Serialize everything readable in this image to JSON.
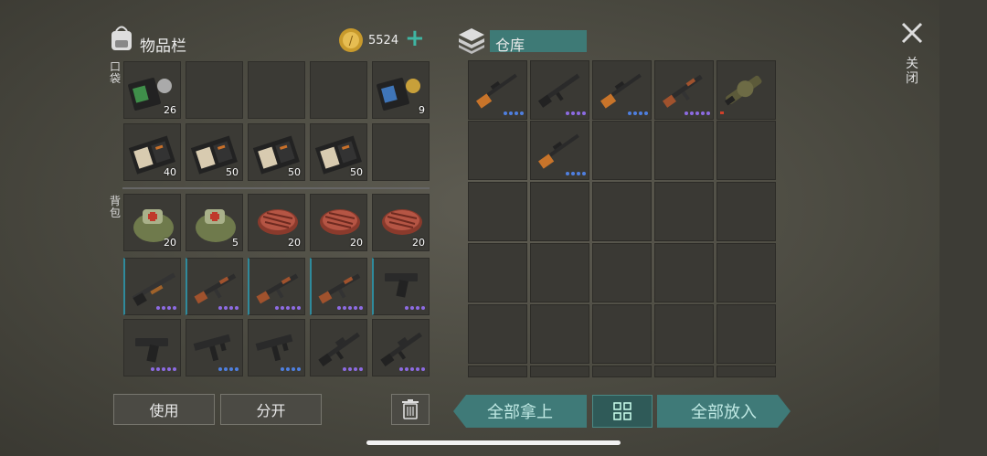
{
  "inventory": {
    "title": "物品栏",
    "coins": "5524",
    "pocket_label": "口袋",
    "backpack_label": "背包",
    "pocket_row1": [
      {
        "icon": "passport-badge-icon",
        "count": "26"
      },
      {
        "icon": "",
        "count": ""
      },
      {
        "icon": "",
        "count": ""
      },
      {
        "icon": "",
        "count": ""
      },
      {
        "icon": "passport-badge-icon",
        "count": "9"
      }
    ],
    "pocket_row2": [
      {
        "icon": "document-booklet-icon",
        "count": "40"
      },
      {
        "icon": "document-booklet-icon",
        "count": "50"
      },
      {
        "icon": "document-booklet-icon",
        "count": "50"
      },
      {
        "icon": "document-booklet-icon",
        "count": "50"
      },
      {
        "icon": "",
        "count": ""
      }
    ],
    "backpack_row1": [
      {
        "icon": "medkit-bag-icon",
        "count": "20"
      },
      {
        "icon": "medkit-bag-icon",
        "count": "5"
      },
      {
        "icon": "steak-icon",
        "count": "20"
      },
      {
        "icon": "steak-icon",
        "count": "20"
      },
      {
        "icon": "steak-icon",
        "count": "20"
      }
    ],
    "backpack_row2": [
      {
        "icon": "shotgun-icon",
        "dots": 4
      },
      {
        "icon": "assault-rifle-icon",
        "dots": 4
      },
      {
        "icon": "assault-rifle-icon",
        "dots": 5
      },
      {
        "icon": "assault-rifle-icon",
        "dots": 5
      },
      {
        "icon": "pistol-icon",
        "dots": 4
      }
    ],
    "backpack_row3": [
      {
        "icon": "pistol-icon",
        "dots": 5
      },
      {
        "icon": "smg-icon",
        "dots": 4
      },
      {
        "icon": "smg-icon",
        "dots": 4
      },
      {
        "icon": "m16-rifle-icon",
        "dots": 4
      },
      {
        "icon": "m16-rifle-icon",
        "dots": 5
      }
    ]
  },
  "storage": {
    "title": "仓库",
    "row1": [
      {
        "icon": "sniper-rifle-icon",
        "dots": 4
      },
      {
        "icon": "m16-rifle-icon",
        "dots": 4
      },
      {
        "icon": "sniper-rifle-icon",
        "dots": 4
      },
      {
        "icon": "assault-rifle-icon",
        "dots": 5
      },
      {
        "icon": "grenade-launcher-icon",
        "dots": 0
      }
    ],
    "row2": [
      {
        "icon": "",
        "dots": 0
      },
      {
        "icon": "sniper-rifle-icon",
        "dots": 4
      }
    ]
  },
  "buttons": {
    "use": "使用",
    "split": "分开",
    "take_all": "全部拿上",
    "put_all": "全部放入",
    "close": "关闭"
  },
  "colors": {
    "accent": "#3f7a78",
    "rarity_purple": "#8d6be3",
    "rarity_blue": "#4f7fe0"
  }
}
